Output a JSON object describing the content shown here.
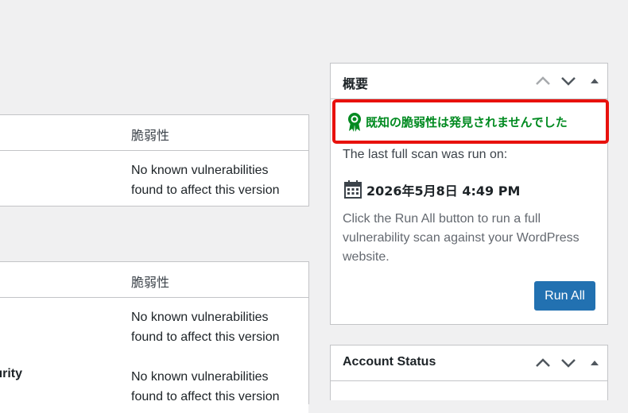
{
  "left_tables": [
    {
      "header": "脆弱性",
      "rows": [
        {
          "name": "",
          "text": "No known vulnerabilities found to affect this version"
        }
      ]
    },
    {
      "header": "脆弱性",
      "rows": [
        {
          "name": "",
          "text": "No known vulnerabilities found to affect this version"
        },
        {
          "name": "urity",
          "text": "No known vulnerabilities found to affect this version"
        }
      ]
    }
  ],
  "summary": {
    "title": "概要",
    "alert": "既知の脆弱性は発見されませんでした",
    "last_scan": "The last full scan was run on:",
    "date": "2026年5月8日 4:49 PM",
    "description": "Click the Run All button to run a full vulnerability scan against your WordPress website.",
    "run_button": "Run All"
  },
  "account": {
    "title": "Account Status"
  },
  "colors": {
    "accent": "#2271b1",
    "success": "#008a20",
    "highlight": "#e8110d"
  }
}
